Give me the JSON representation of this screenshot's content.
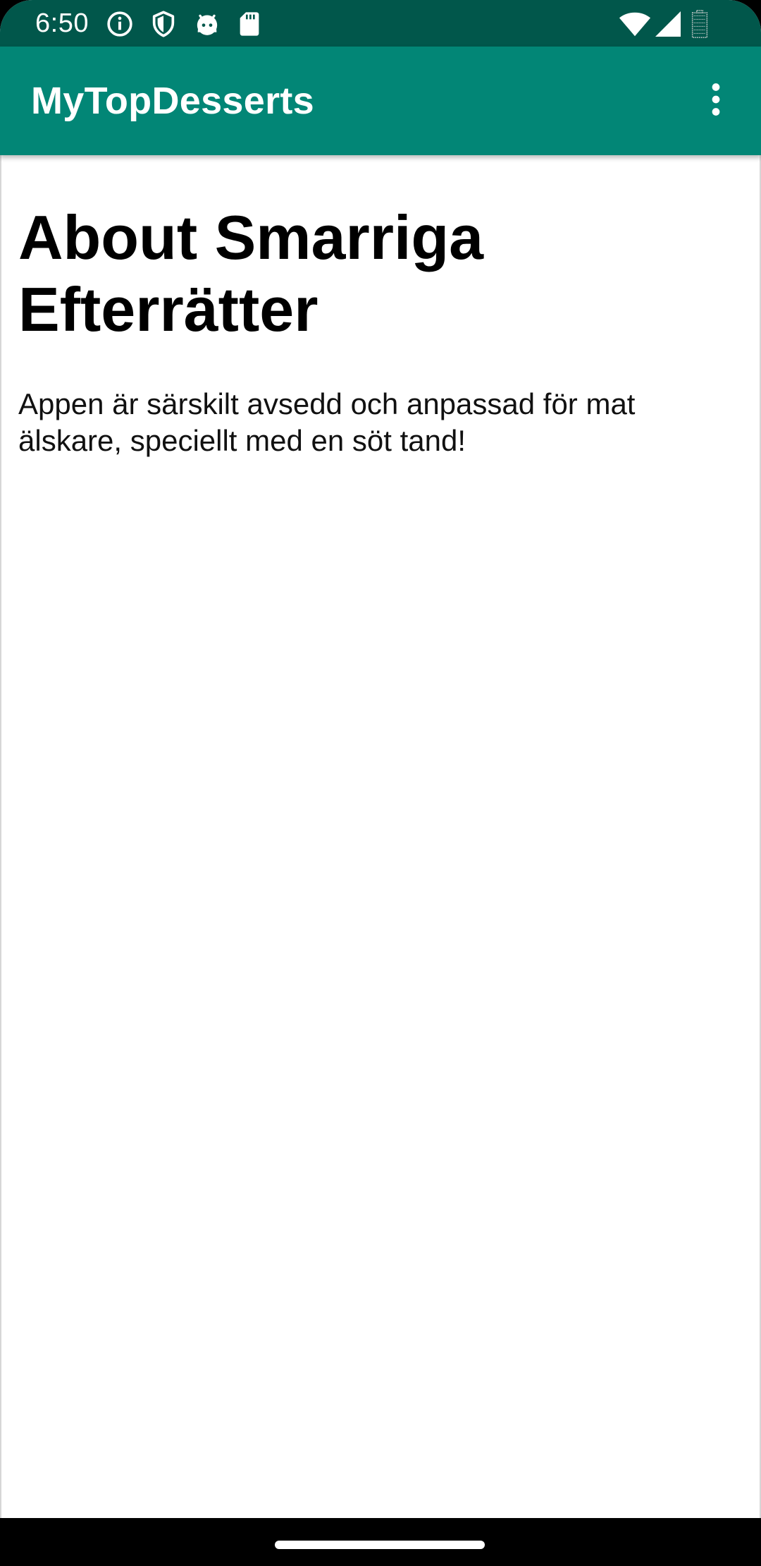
{
  "status_bar": {
    "time": "6:50",
    "icons": [
      "info-icon",
      "shield-icon",
      "android-debug-icon",
      "sd-card-icon",
      "wifi-icon",
      "cell-signal-icon",
      "battery-icon"
    ]
  },
  "app_bar": {
    "title": "MyTopDesserts",
    "overflow_icon": "more-vert-icon"
  },
  "content": {
    "heading": "About Smarriga Efterrätter",
    "body": "Appen är särskilt avsedd och anpassad för mat älskare, speciellt med en söt tand!"
  },
  "colors": {
    "status_bar": "#01574b",
    "app_bar": "#028676",
    "background": "#ffffff",
    "nav_bar": "#000000"
  }
}
